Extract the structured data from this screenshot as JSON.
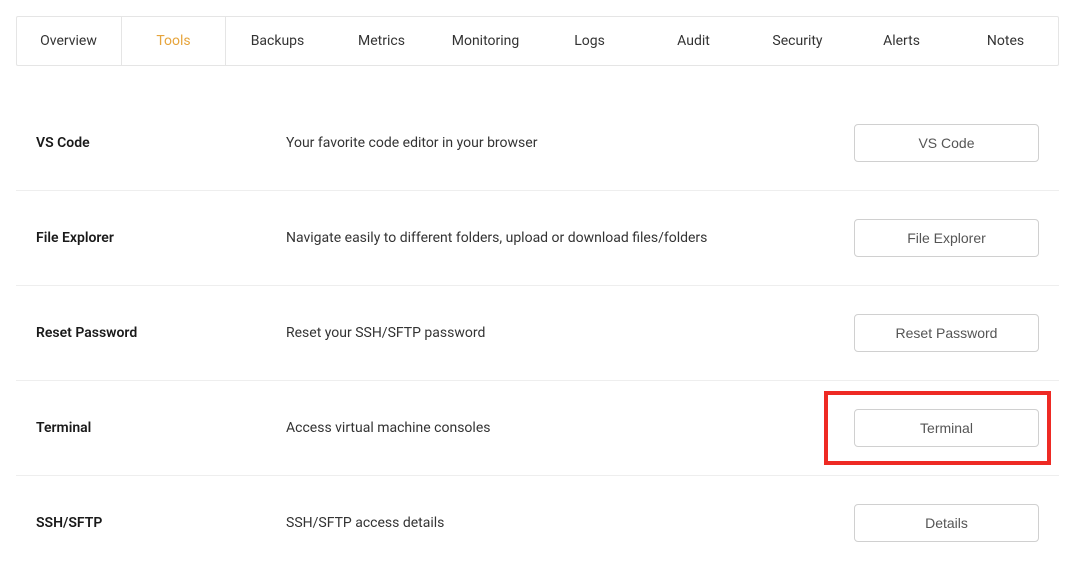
{
  "tabs": [
    {
      "label": "Overview",
      "active": false
    },
    {
      "label": "Tools",
      "active": true
    },
    {
      "label": "Backups",
      "active": false
    },
    {
      "label": "Metrics",
      "active": false
    },
    {
      "label": "Monitoring",
      "active": false
    },
    {
      "label": "Logs",
      "active": false
    },
    {
      "label": "Audit",
      "active": false
    },
    {
      "label": "Security",
      "active": false
    },
    {
      "label": "Alerts",
      "active": false
    },
    {
      "label": "Notes",
      "active": false
    }
  ],
  "rows": [
    {
      "title": "VS Code",
      "desc": "Your favorite code editor in your browser",
      "button": "VS Code",
      "highlight": false
    },
    {
      "title": "File Explorer",
      "desc": "Navigate easily to different folders, upload or download files/folders",
      "button": "File Explorer",
      "highlight": false
    },
    {
      "title": "Reset Password",
      "desc": "Reset your SSH/SFTP password",
      "button": "Reset Password",
      "highlight": false
    },
    {
      "title": "Terminal",
      "desc": "Access virtual machine consoles",
      "button": "Terminal",
      "highlight": true
    },
    {
      "title": "SSH/SFTP",
      "desc": "SSH/SFTP access details",
      "button": "Details",
      "highlight": false
    }
  ]
}
